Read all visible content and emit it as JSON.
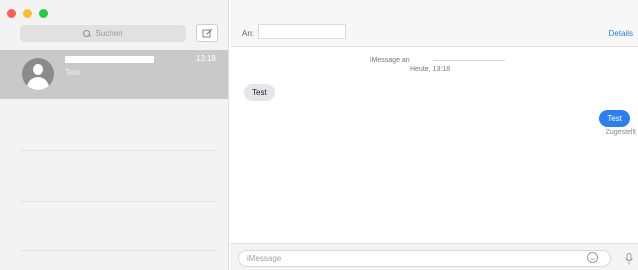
{
  "sidebar": {
    "search_placeholder": "Suchen",
    "conversations": [
      {
        "preview": "Test",
        "time": "13:18"
      }
    ]
  },
  "header": {
    "to_label": "An:",
    "to_value": "",
    "details_label": "Details"
  },
  "thread": {
    "service_label": "iMessage an",
    "timestamp": "Heute, 13:18",
    "messages": [
      {
        "direction": "incoming",
        "text": "Test"
      },
      {
        "direction": "outgoing",
        "text": "Test",
        "status": "Zugestellt"
      }
    ]
  },
  "composer": {
    "placeholder": "iMessage"
  },
  "colors": {
    "accent": "#2d7ff0",
    "selected_row": "#c9c9c9",
    "incoming_bubble": "#e5e5ea"
  }
}
